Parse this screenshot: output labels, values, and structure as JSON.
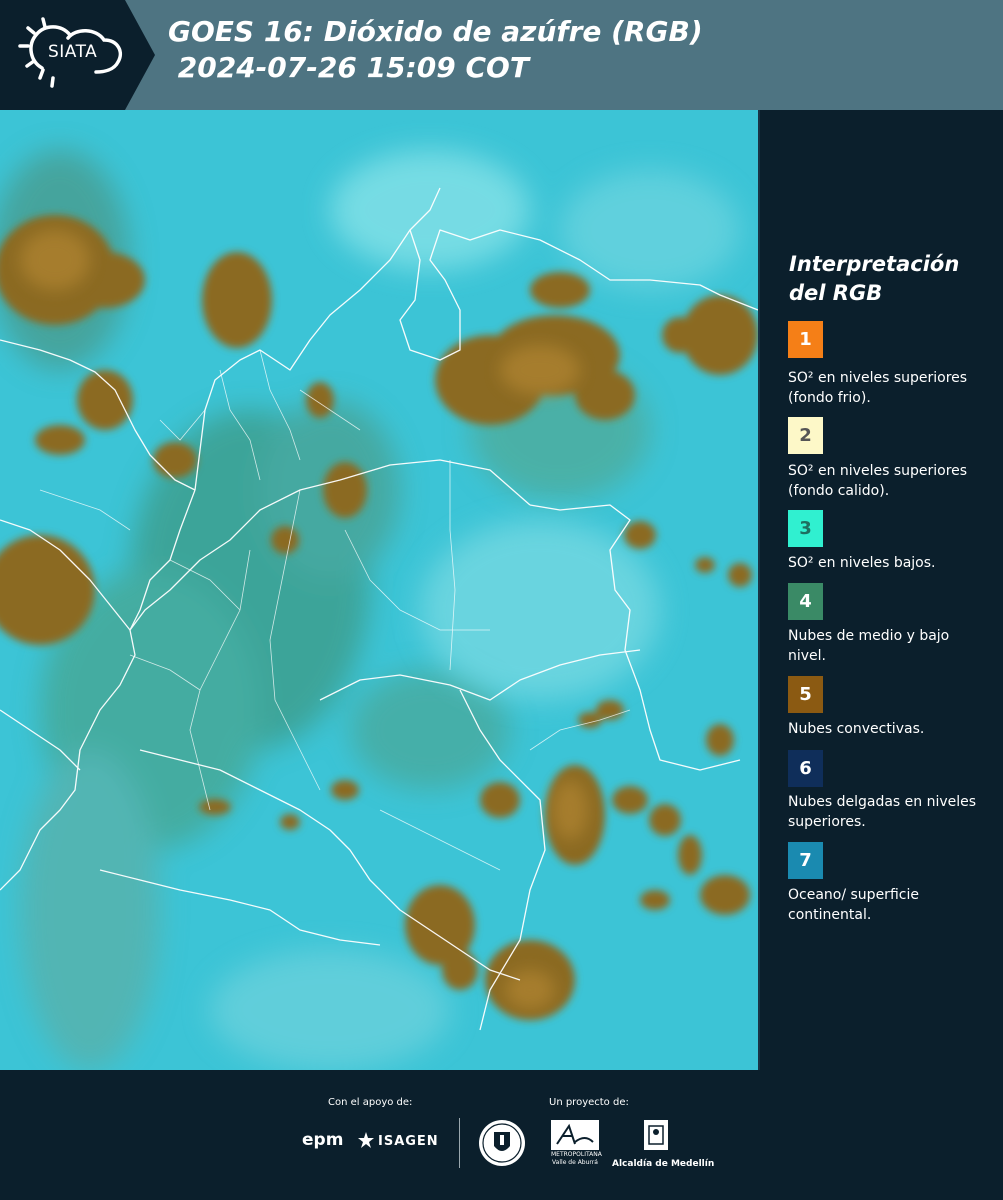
{
  "header": {
    "logo_text": "SIATA",
    "title": "GOES 16: Dióxido de azúfre (RGB)\n 2024-07-26 15:09 COT",
    "logo_icon": "sun-cloud-icon",
    "colors": {
      "header": "#4e7482",
      "logo_bg": "#0b1f2c"
    }
  },
  "legend": {
    "title": "Interpretación del RGB",
    "items": [
      {
        "number": "1",
        "color": "#f57f17",
        "text_color": "#ffffff",
        "text": "SO² en niveles superiores (fondo frio)."
      },
      {
        "number": "2",
        "color": "#fdf8c8",
        "text_color": "#555555",
        "text": "SO² en niveles superiores (fondo calido)."
      },
      {
        "number": "3",
        "color": "#30f0d0",
        "text_color": "#1e6e60",
        "text": "SO² en niveles bajos."
      },
      {
        "number": "4",
        "color": "#3a8a66",
        "text_color": "#ffffff",
        "text": "Nubes de medio y bajo nivel."
      },
      {
        "number": "5",
        "color": "#8b5a12",
        "text_color": "#ffffff",
        "text": "Nubes convectivas."
      },
      {
        "number": "6",
        "color": "#0f2e5a",
        "text_color": "#ffffff",
        "text": "Nubes delgadas en niveles superiores."
      },
      {
        "number": "7",
        "color": "#1a8ab0",
        "text_color": "#ffffff",
        "text": "Oceano/ superficie continental."
      }
    ]
  },
  "footer": {
    "support_label": "Con el apoyo de:",
    "project_label": "Un proyecto de:",
    "sponsors": [
      "epm",
      "ISAGEN"
    ],
    "partners": [
      "METROPOLITANA",
      "Valle de Aburrá",
      "Alcaldía de Medellín"
    ]
  }
}
